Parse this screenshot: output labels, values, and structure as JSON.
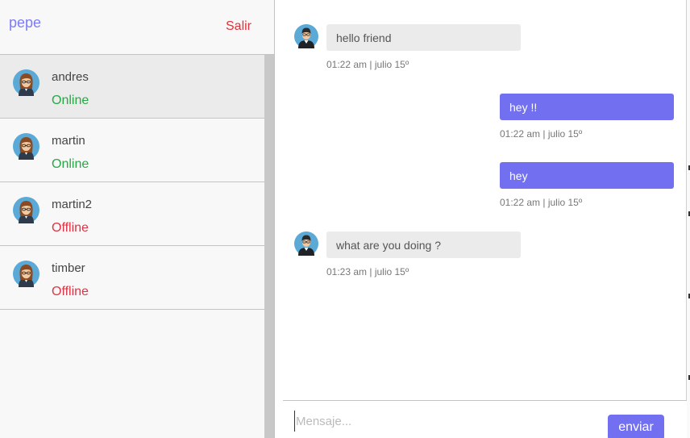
{
  "header": {
    "username": "pepe",
    "logout_label": "Salir"
  },
  "contacts": [
    {
      "name": "andres",
      "status": "Online",
      "active": true
    },
    {
      "name": "martin",
      "status": "Online",
      "active": false
    },
    {
      "name": "martin2",
      "status": "Offline",
      "active": false
    },
    {
      "name": "timber",
      "status": "Offline",
      "active": false
    }
  ],
  "messages": [
    {
      "direction": "incoming",
      "text": "hello friend",
      "time": "01:22 am | julio 15º"
    },
    {
      "direction": "outgoing",
      "text": "hey !!",
      "time": "01:22 am | julio 15º"
    },
    {
      "direction": "outgoing",
      "text": "hey",
      "time": "01:22 am | julio 15º"
    },
    {
      "direction": "incoming",
      "text": "what are you doing ?",
      "time": "01:23 am | julio 15º"
    }
  ],
  "composer": {
    "placeholder": "Mensaje...",
    "send_label": "enviar"
  },
  "colors": {
    "accent": "#7270f0",
    "online": "#28a745",
    "offline": "#dc3545",
    "logout": "#e0303a"
  },
  "icons": {
    "contact_avatar": "female-avatar-icon",
    "message_avatar": "male-avatar-icon"
  }
}
